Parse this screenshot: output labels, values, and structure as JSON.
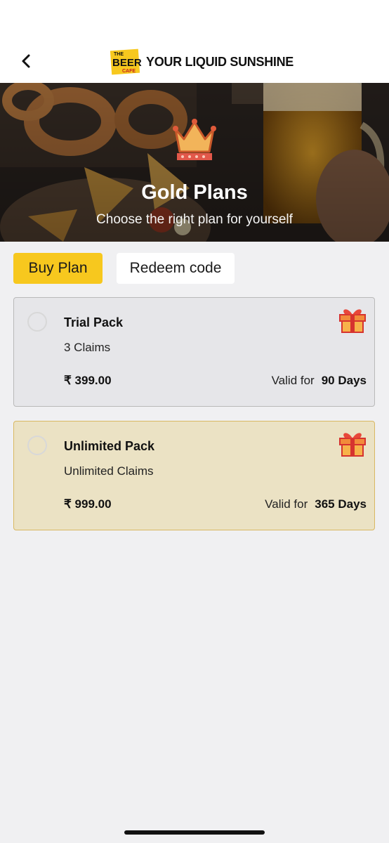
{
  "header": {
    "back_icon": "chevron-left-icon",
    "logo": {
      "top_word": "THE",
      "main_word": "BEER",
      "bottom_word": "CAFE",
      "color": "#f7c81e"
    },
    "tagline": "YOUR LIQUID SUNSHINE"
  },
  "hero": {
    "icon": "crown-icon",
    "title": "Gold Plans",
    "subtitle": "Choose the right plan for yourself"
  },
  "tabs": [
    {
      "label": "Buy Plan",
      "active": true
    },
    {
      "label": "Redeem code",
      "active": false
    }
  ],
  "plans": [
    {
      "name": "Trial Pack",
      "claims": "3 Claims",
      "price": "₹ 399.00",
      "valid_label": "Valid for",
      "duration": "90 Days",
      "selected": false,
      "icon": "gift-icon"
    },
    {
      "name": "Unlimited Pack",
      "claims": "Unlimited Claims",
      "price": "₹ 999.00",
      "valid_label": "Valid for",
      "duration": "365 Days",
      "selected": false,
      "highlighted": true,
      "icon": "gift-icon"
    }
  ],
  "colors": {
    "accent": "#f7c81e",
    "highlight_card": "#ebe2c4",
    "card": "#e6e6e9",
    "background": "#f0f0f2"
  }
}
